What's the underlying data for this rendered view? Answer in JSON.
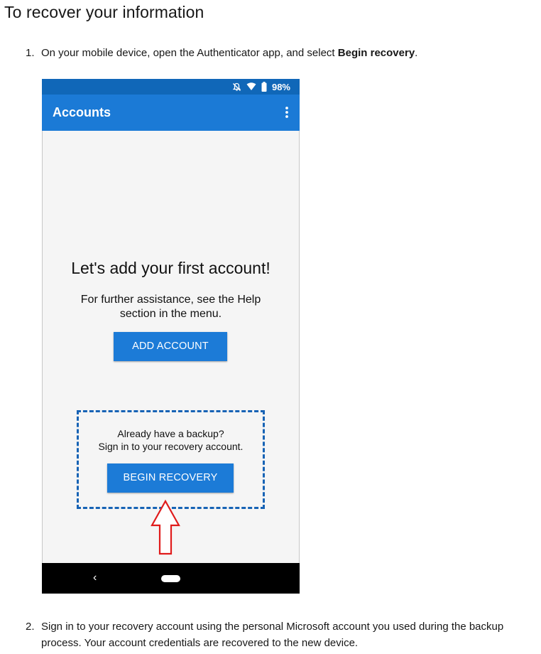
{
  "page": {
    "title": "To recover your information"
  },
  "steps": [
    {
      "number": "1.",
      "text_before": "On your mobile device, open the Authenticator app, and select ",
      "bold": "Begin recovery",
      "text_after": "."
    },
    {
      "number": "2.",
      "text": "Sign in to your recovery account using the personal Microsoft account you used during the backup process. Your account credentials are recovered to the new device."
    }
  ],
  "phone": {
    "status_bar": {
      "battery": "98%",
      "icons": [
        "mute-icon",
        "wifi-icon",
        "battery-icon"
      ]
    },
    "app_bar": {
      "title": "Accounts",
      "menu_icon": "more-vert-icon"
    },
    "empty_state": {
      "headline": "Let's add your first account!",
      "help_line1": "For further assistance, see the Help",
      "help_line2": "section in the menu.",
      "add_account_label": "ADD ACCOUNT"
    },
    "recovery": {
      "line1": "Already have a backup?",
      "line2": "Sign in to your recovery account.",
      "begin_recovery_label": "BEGIN RECOVERY"
    },
    "nav_bar": {
      "back_glyph": "‹"
    }
  },
  "colors": {
    "status_bar": "#1067b8",
    "app_bar": "#1b7ad6",
    "button": "#1c7bd7",
    "highlight_border": "#1763b5",
    "arrow": "#e01b1b"
  }
}
